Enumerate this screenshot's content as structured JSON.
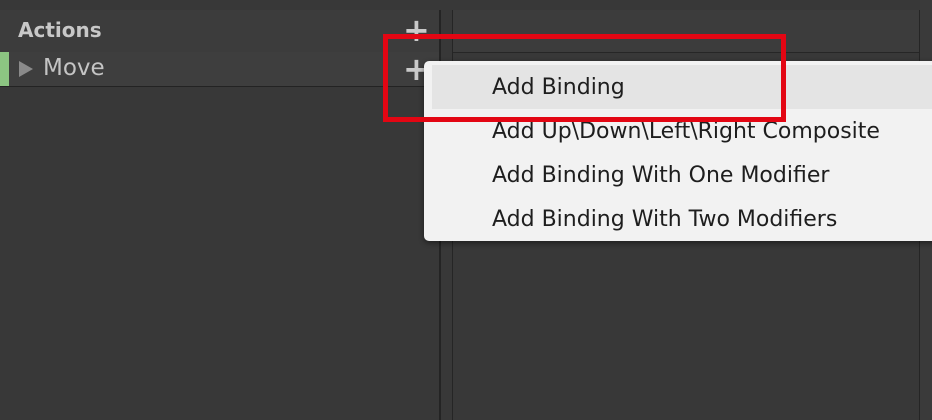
{
  "actions_panel": {
    "title": "Actions",
    "add_icon": "plus-icon",
    "items": [
      {
        "label": "Move",
        "expand_icon": "triangle-right-icon",
        "add_icon": "plus-icon",
        "color": "#8cc582"
      }
    ]
  },
  "context_menu": {
    "items": [
      {
        "label": "Add Binding"
      },
      {
        "label": "Add Up\\Down\\Left\\Right Composite"
      },
      {
        "label": "Add Binding With One Modifier"
      },
      {
        "label": "Add Binding With Two Modifiers"
      }
    ]
  },
  "colors": {
    "panel_bg": "#383838",
    "menu_bg": "#f2f2f2",
    "highlight_box": "#e30613",
    "action_accent": "#8cc582"
  }
}
